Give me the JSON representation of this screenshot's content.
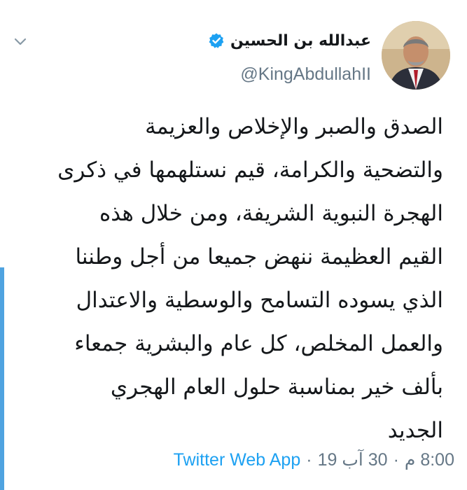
{
  "user": {
    "display_name": "عبدالله بن الحسين",
    "handle": "@KingAbdullahII",
    "verified": true
  },
  "tweet": {
    "lines": [
      "الصدق والصبر والإخلاص والعزيمة",
      "والتضحية والكرامة، قيم نستلهمها في ذكرى",
      "الهجرة النبوية الشريفة، ومن خلال هذه",
      "القيم العظيمة ننهض جميعا من أجل وطننا",
      "الذي يسوده التسامح والوسطية والاعتدال",
      "والعمل المخلص، كل عام والبشرية جمعاء",
      "بألف خير بمناسبة حلول العام الهجري",
      "الجديد"
    ]
  },
  "meta": {
    "source": "Twitter Web App",
    "separator": "·",
    "date": "30 آب 19",
    "time": "8:00 م"
  },
  "colors": {
    "link": "#1da1f2",
    "muted": "#657786",
    "text": "#14171a",
    "accent_bar": "#4fa3e0",
    "verified": "#1da1f2"
  },
  "icons": {
    "menu": "chevron-down-icon",
    "verified": "verified-badge-icon"
  }
}
